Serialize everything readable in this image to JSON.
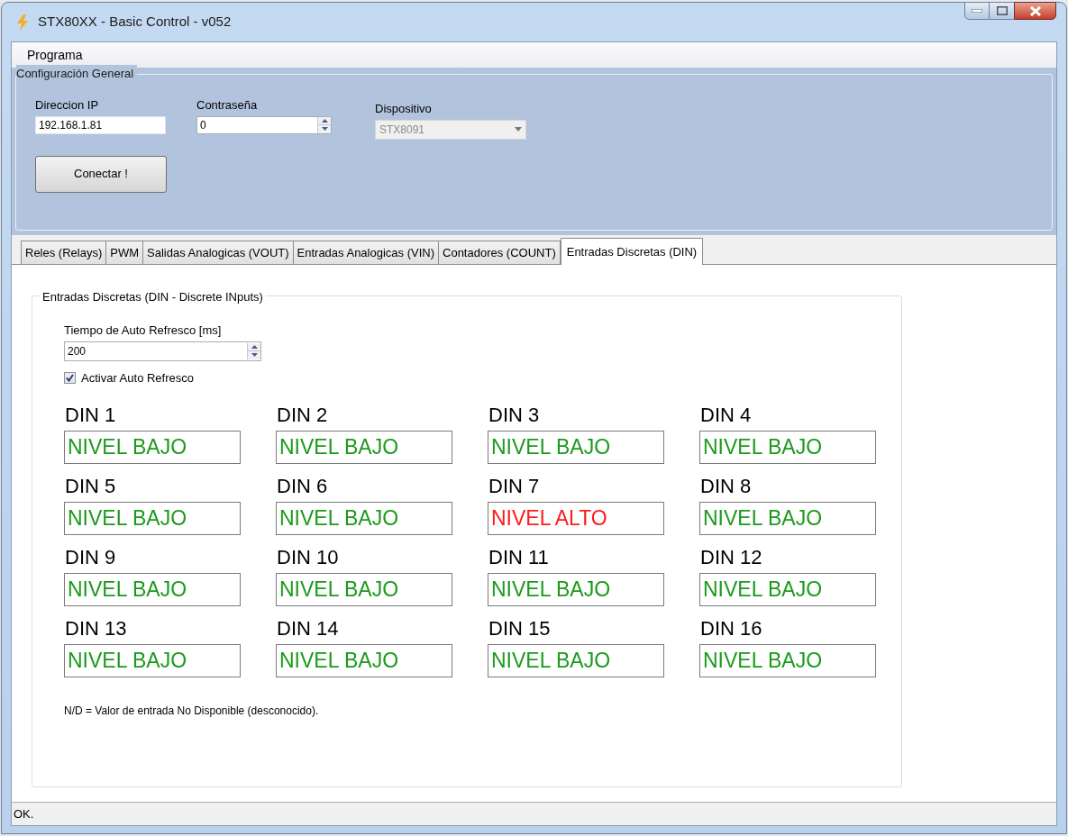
{
  "window": {
    "title": "STX80XX - Basic Control - v052"
  },
  "menu": [
    "Programa"
  ],
  "config": {
    "title": "Configuración General",
    "ip": {
      "label": "Direccion IP",
      "value": "192.168.1.81"
    },
    "password": {
      "label": "Contraseña",
      "value": "0"
    },
    "device": {
      "label": "Dispositivo",
      "value": "STX8091",
      "disabled": true
    },
    "connect_button": "Conectar !"
  },
  "tabs": [
    {
      "label": "Reles (Relays)",
      "selected": false
    },
    {
      "label": "PWM",
      "selected": false
    },
    {
      "label": "Salidas Analogicas (VOUT)",
      "selected": false
    },
    {
      "label": "Entradas Analogicas (VIN)",
      "selected": false
    },
    {
      "label": "Contadores (COUNT)",
      "selected": false
    },
    {
      "label": "Entradas Discretas (DIN)",
      "selected": true
    }
  ],
  "din_group": {
    "title": "Entradas Discretas (DIN - Discrete INputs)",
    "refresh": {
      "label": "Tiempo de Auto Refresco [ms]",
      "value": "200"
    },
    "auto_refresh": {
      "label": "Activar Auto Refresco",
      "checked": true
    },
    "inputs": [
      {
        "label": "DIN 1",
        "value": "NIVEL BAJO",
        "high": false
      },
      {
        "label": "DIN 2",
        "value": "NIVEL BAJO",
        "high": false
      },
      {
        "label": "DIN 3",
        "value": "NIVEL BAJO",
        "high": false
      },
      {
        "label": "DIN 4",
        "value": "NIVEL BAJO",
        "high": false
      },
      {
        "label": "DIN 5",
        "value": "NIVEL BAJO",
        "high": false
      },
      {
        "label": "DIN 6",
        "value": "NIVEL BAJO",
        "high": false
      },
      {
        "label": "DIN 7",
        "value": "NIVEL ALTO",
        "high": true
      },
      {
        "label": "DIN 8",
        "value": "NIVEL BAJO",
        "high": false
      },
      {
        "label": "DIN 9",
        "value": "NIVEL BAJO",
        "high": false
      },
      {
        "label": "DIN 10",
        "value": "NIVEL BAJO",
        "high": false
      },
      {
        "label": "DIN 11",
        "value": "NIVEL BAJO",
        "high": false
      },
      {
        "label": "DIN 12",
        "value": "NIVEL BAJO",
        "high": false
      },
      {
        "label": "DIN 13",
        "value": "NIVEL BAJO",
        "high": false
      },
      {
        "label": "DIN 14",
        "value": "NIVEL BAJO",
        "high": false
      },
      {
        "label": "DIN 15",
        "value": "NIVEL BAJO",
        "high": false
      },
      {
        "label": "DIN 16",
        "value": "NIVEL BAJO",
        "high": false
      }
    ],
    "note": "N/D = Valor de entrada No Disponible (desconocido)."
  },
  "status_bar": "OK."
}
